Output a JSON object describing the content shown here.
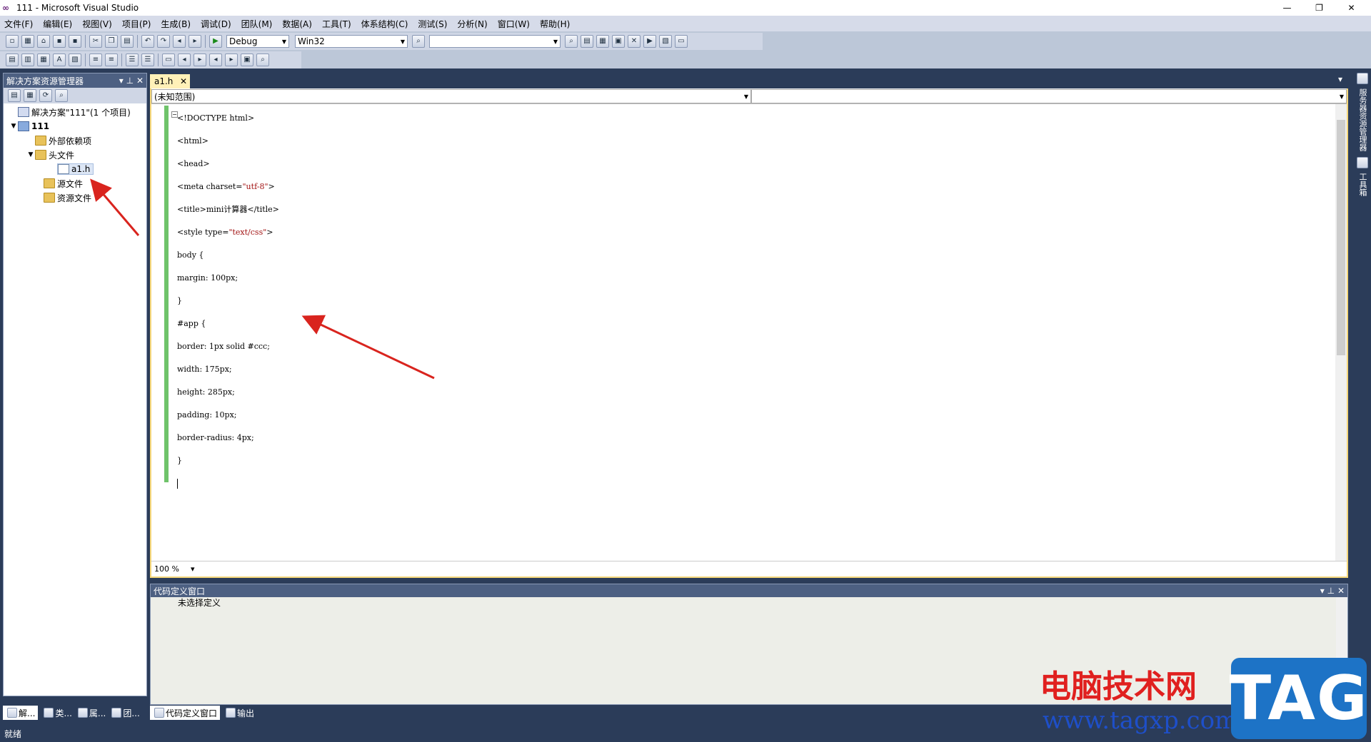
{
  "window": {
    "title": "111 - Microsoft Visual Studio",
    "logo": "∞"
  },
  "menu": [
    "文件(F)",
    "编辑(E)",
    "视图(V)",
    "项目(P)",
    "生成(B)",
    "调试(D)",
    "团队(M)",
    "数据(A)",
    "工具(T)",
    "体系结构(C)",
    "测试(S)",
    "分析(N)",
    "窗口(W)",
    "帮助(H)"
  ],
  "toolbar": {
    "config": "Debug",
    "platform": "Win32",
    "find_value": ""
  },
  "solution_explorer": {
    "title": "解决方案资源管理器",
    "items": [
      {
        "label": "解决方案\"111\"(1 个项目)",
        "level": 0,
        "icon": "solution-icon"
      },
      {
        "label": "111",
        "level": 0,
        "icon": "project-icon",
        "expanded": true
      },
      {
        "label": "外部依赖项",
        "level": 1,
        "icon": "folder-icon"
      },
      {
        "label": "头文件",
        "level": 1,
        "icon": "folder-icon",
        "expanded": true
      },
      {
        "label": "a1.h",
        "level": 2,
        "icon": "header-file-icon",
        "selected": true
      },
      {
        "label": "源文件",
        "level": 1,
        "icon": "folder-icon"
      },
      {
        "label": "资源文件",
        "level": 1,
        "icon": "folder-icon"
      }
    ],
    "bottom_tabs": [
      "解...",
      "类...",
      "属...",
      "团..."
    ]
  },
  "editor": {
    "tab": "a1.h",
    "scope": "(未知范围)",
    "zoom": "100 %",
    "lines": [
      [
        {
          "t": "<!DOCTYPE html>"
        }
      ],
      [
        {
          "t": "<html>"
        }
      ],
      [
        {
          "t": "<head>"
        }
      ],
      [
        {
          "t": "<meta charset="
        },
        {
          "t": "\"utf-8\"",
          "s": true
        },
        {
          "t": ">"
        }
      ],
      [
        {
          "t": "<title>mini计算器</title>"
        }
      ],
      [
        {
          "t": "<style type="
        },
        {
          "t": "\"text/css\"",
          "s": true
        },
        {
          "t": ">"
        }
      ],
      [
        {
          "t": "body {"
        }
      ],
      [
        {
          "t": "margin: 100px;"
        }
      ],
      [
        {
          "t": "}"
        }
      ],
      [
        {
          "t": "#app {"
        }
      ],
      [
        {
          "t": "border: 1px solid #ccc;"
        }
      ],
      [
        {
          "t": "width: 175px;"
        }
      ],
      [
        {
          "t": "height: 285px;"
        }
      ],
      [
        {
          "t": "padding: 10px;"
        }
      ],
      [
        {
          "t": "border-radius: 4px;"
        }
      ],
      [
        {
          "t": "}"
        }
      ],
      [
        {
          "t": ""
        }
      ]
    ]
  },
  "code_definition": {
    "title": "代码定义窗口",
    "content": "未选择定义",
    "bottom_tabs": [
      "代码定义窗口",
      "输出"
    ]
  },
  "right_strip": [
    "服务器资源管理器",
    "工具箱"
  ],
  "status": "就绪",
  "watermark": {
    "text": "电脑技术网",
    "url": "www.tagxp.com",
    "tag": "TAG"
  },
  "colors": {
    "accent": "#2b3c59",
    "highlight": "#f5d77a",
    "annotation": "#d9241e"
  }
}
